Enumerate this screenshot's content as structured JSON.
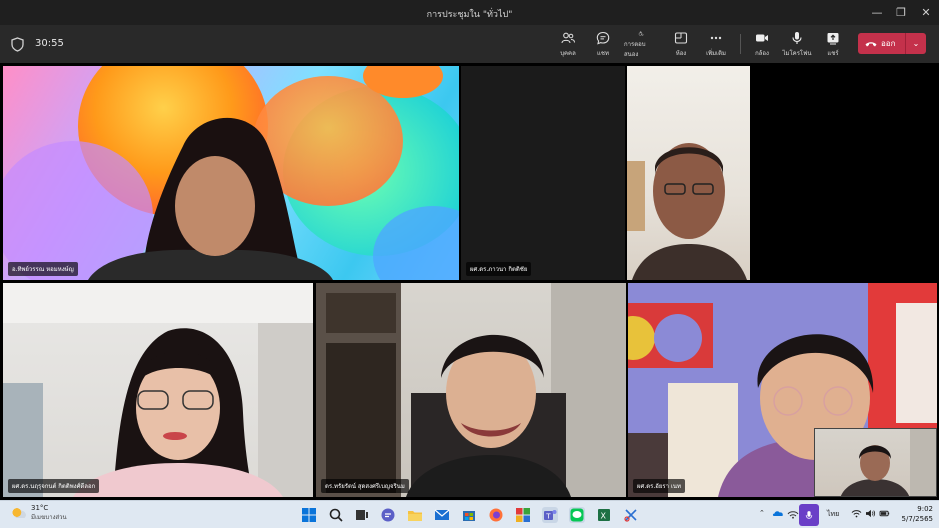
{
  "window": {
    "title": "การประชุมใน \"ทั่วไป\"",
    "minimize": "—",
    "maximize": "❐",
    "close": "✕"
  },
  "toolbar": {
    "timer": "30:55",
    "buttons": [
      {
        "label": "บุคคล",
        "icon": "people-icon"
      },
      {
        "label": "แชท",
        "icon": "chat-icon"
      },
      {
        "label": "การตอบสนอง",
        "icon": "react-icon"
      },
      {
        "label": "ห้อง",
        "icon": "rooms-icon"
      },
      {
        "label": "เพิ่มเติม",
        "icon": "more-icon"
      },
      {
        "label": "กล้อง",
        "icon": "camera-icon"
      },
      {
        "label": "ไมโครโฟน",
        "icon": "mic-icon"
      },
      {
        "label": "แชร์",
        "icon": "share-icon"
      }
    ],
    "leave_label": "ออก",
    "leave_color": "#c4314b"
  },
  "participants": [
    {
      "name": "อ.ทิพย์วรรณ หอมหงษ์ญ"
    },
    {
      "name": "ผศ.ดร.ภาวนา กิตติชัย"
    },
    {
      "name": ""
    },
    {
      "name": "ผศ.ดร.นฤรุจกนต์ กิตติพงศ์ดีลอก"
    },
    {
      "name": "ดร.ทรัยรัตน์ สุดสงศรีเบญจรินม"
    },
    {
      "name": "ผศ.ดร.อัยรา เนท"
    }
  ],
  "taskbar": {
    "weather_temp": "31°C",
    "weather_cond": "มีเมฆบางส่วน",
    "language": "ไทย",
    "time": "9:02",
    "date": "5/7/2565"
  }
}
